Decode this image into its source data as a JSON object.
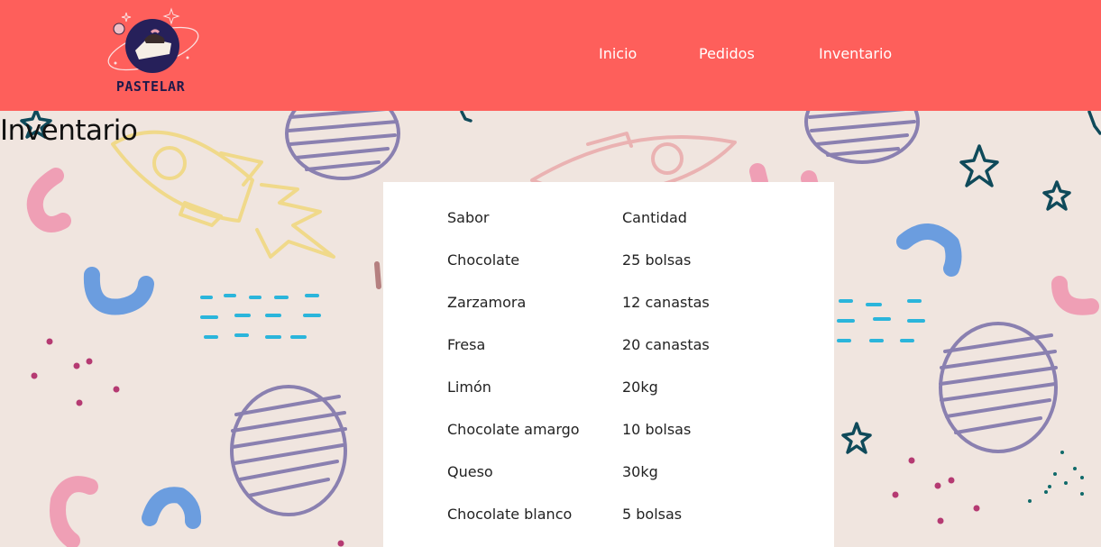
{
  "brand": {
    "name": "PASTELAR"
  },
  "nav": {
    "items": [
      "Inicio",
      "Pedidos",
      "Inventario"
    ]
  },
  "page": {
    "title": "Inventario"
  },
  "inventory": {
    "headers": [
      "Sabor",
      "Cantidad"
    ],
    "rows": [
      [
        "Chocolate",
        "25 bolsas"
      ],
      [
        "Zarzamora",
        "12 canastas"
      ],
      [
        "Fresa",
        "20 canastas"
      ],
      [
        "Limón",
        "20kg"
      ],
      [
        "Chocolate amargo",
        "10 bolsas"
      ],
      [
        "Queso",
        "30kg"
      ],
      [
        "Chocolate blanco",
        "5 bolsas"
      ]
    ]
  },
  "colors": {
    "header": "#fe5f5b",
    "background": "#f0e5df",
    "card": "#ffffff",
    "nav_text": "#ffffff"
  }
}
